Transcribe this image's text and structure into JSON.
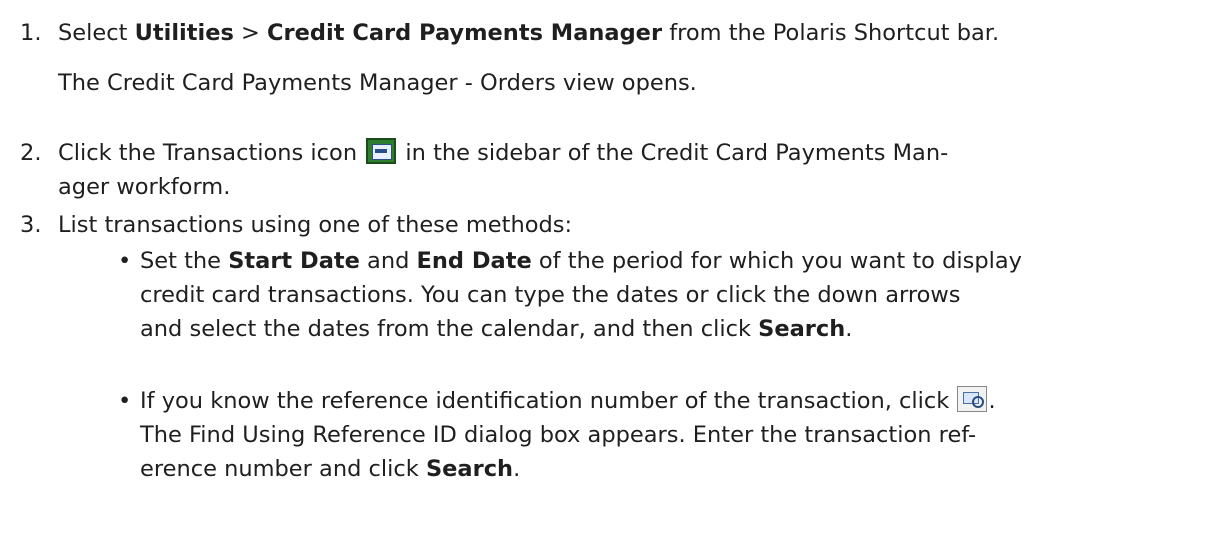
{
  "steps": [
    {
      "num": "1.",
      "pre": "Select ",
      "b1": "Utilities",
      "mid": " > ",
      "b2": "Credit Card Payments Manager",
      "post": " from the Polaris Shortcut bar.",
      "note": "The Credit Card Payments Manager - Orders view opens."
    },
    {
      "num": "2.",
      "pre": "Click the Transactions icon",
      "post1": " in the sidebar of the Credit Card Payments Man-",
      "post2": "ager workform.",
      "icon": "transactions-icon"
    },
    {
      "num": "3.",
      "text": "List transactions using one of these methods:"
    }
  ],
  "bullets": [
    {
      "glyph": "•",
      "t1": "Set the ",
      "b1": "Start Date",
      "t2": " and ",
      "b2": "End Date",
      "t3": " of the period for which you want to display",
      "line2": "credit card transactions. You can type the dates or click the down arrows",
      "line3pre": "and select the dates from the calendar, and then click ",
      "b3": "Search",
      "line3post": "."
    },
    {
      "glyph": "•",
      "line1": "If you know the reference identification number of the transaction, click ",
      "line1post": ".",
      "icon": "find-reference-icon",
      "line2": "The Find Using Reference ID dialog box appears. Enter the transaction ref-",
      "line3pre": "erence number and click ",
      "b": "Search",
      "line3post": "."
    }
  ]
}
